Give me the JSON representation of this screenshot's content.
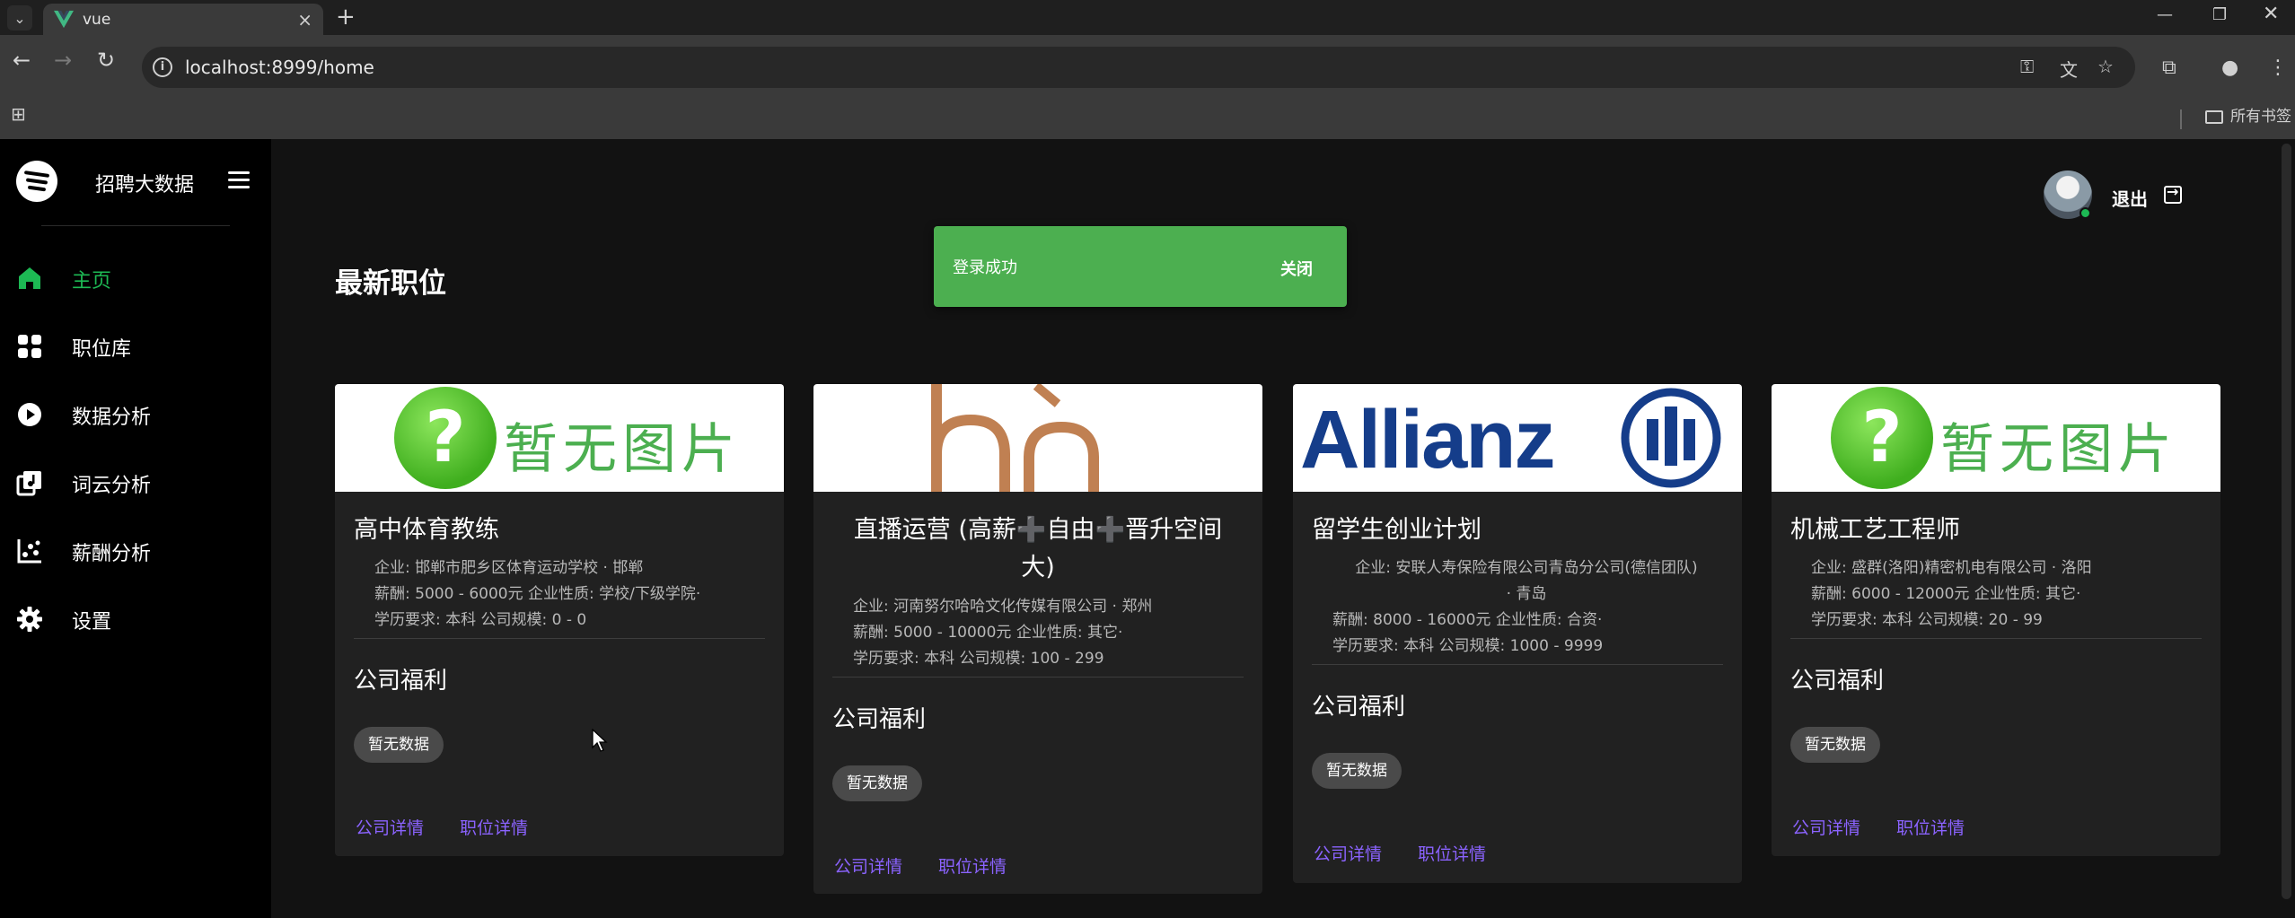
{
  "browser": {
    "tab_title": "vue",
    "url": "localhost:8999/home",
    "bookmarks_label": "所有书签"
  },
  "app": {
    "brand": "招聘大数据",
    "menu": [
      {
        "label": "主页",
        "icon": "home-icon",
        "active": true
      },
      {
        "label": "职位库",
        "icon": "grid-icon",
        "active": false
      },
      {
        "label": "数据分析",
        "icon": "play-circle-icon",
        "active": false
      },
      {
        "label": "词云分析",
        "icon": "music-library-icon",
        "active": false
      },
      {
        "label": "薪酬分析",
        "icon": "scatter-chart-icon",
        "active": false
      },
      {
        "label": "设置",
        "icon": "gear-icon",
        "active": false
      }
    ],
    "logout_label": "退出",
    "page_title": "最新职位",
    "toast": {
      "message": "登录成功",
      "close_label": "关闭"
    },
    "colors": {
      "accent": "#1db954",
      "toast": "#4caf50",
      "link": "#8b63ff"
    }
  },
  "jobs": [
    {
      "image": "暂无图片",
      "title": "高中体育教练",
      "company_line": "企业:   邯郸市肥乡区体育运动学校 · 邯郸",
      "salary_line": "薪酬:   5000 - 6000元    企业性质:  学校/下级学院·",
      "edu_line": "学历要求:  本科    公司规模:  0 - 0",
      "welfare_title": "公司福利",
      "chip": "暂无数据",
      "company_link": "公司详情",
      "job_link": "职位详情"
    },
    {
      "image": "logo",
      "title_l1": "直播运营 (高薪➕自由➕晋升空间",
      "title_l2": "大)",
      "company_line": "企业:   河南努尔哈哈文化传媒有限公司 · 郑州",
      "salary_line": "薪酬:   5000 - 10000元    企业性质:  其它·",
      "edu_line": "学历要求:  本科    公司规模:  100 - 299",
      "welfare_title": "公司福利",
      "chip": "暂无数据",
      "company_link": "公司详情",
      "job_link": "职位详情"
    },
    {
      "image": "Allianz",
      "title": "留学生创业计划",
      "company_line1": "企业:   安联人寿保险有限公司青岛分公司(德信团队)",
      "company_line2": "· 青岛",
      "salary_line": "薪酬:   8000 - 16000元    企业性质:  合资·",
      "edu_line": "学历要求:  本科    公司规模:  1000 - 9999",
      "welfare_title": "公司福利",
      "chip": "暂无数据",
      "company_link": "公司详情",
      "job_link": "职位详情"
    },
    {
      "image": "暂无图片",
      "title": "机械工艺工程师",
      "company_line": "企业:   盛群(洛阳)精密机电有限公司 · 洛阳",
      "salary_line": "薪酬:   6000 - 12000元    企业性质:  其它·",
      "edu_line": "学历要求:  本科    公司规模:  20 - 99",
      "welfare_title": "公司福利",
      "chip": "暂无数据",
      "company_link": "公司详情",
      "job_link": "职位详情"
    }
  ]
}
